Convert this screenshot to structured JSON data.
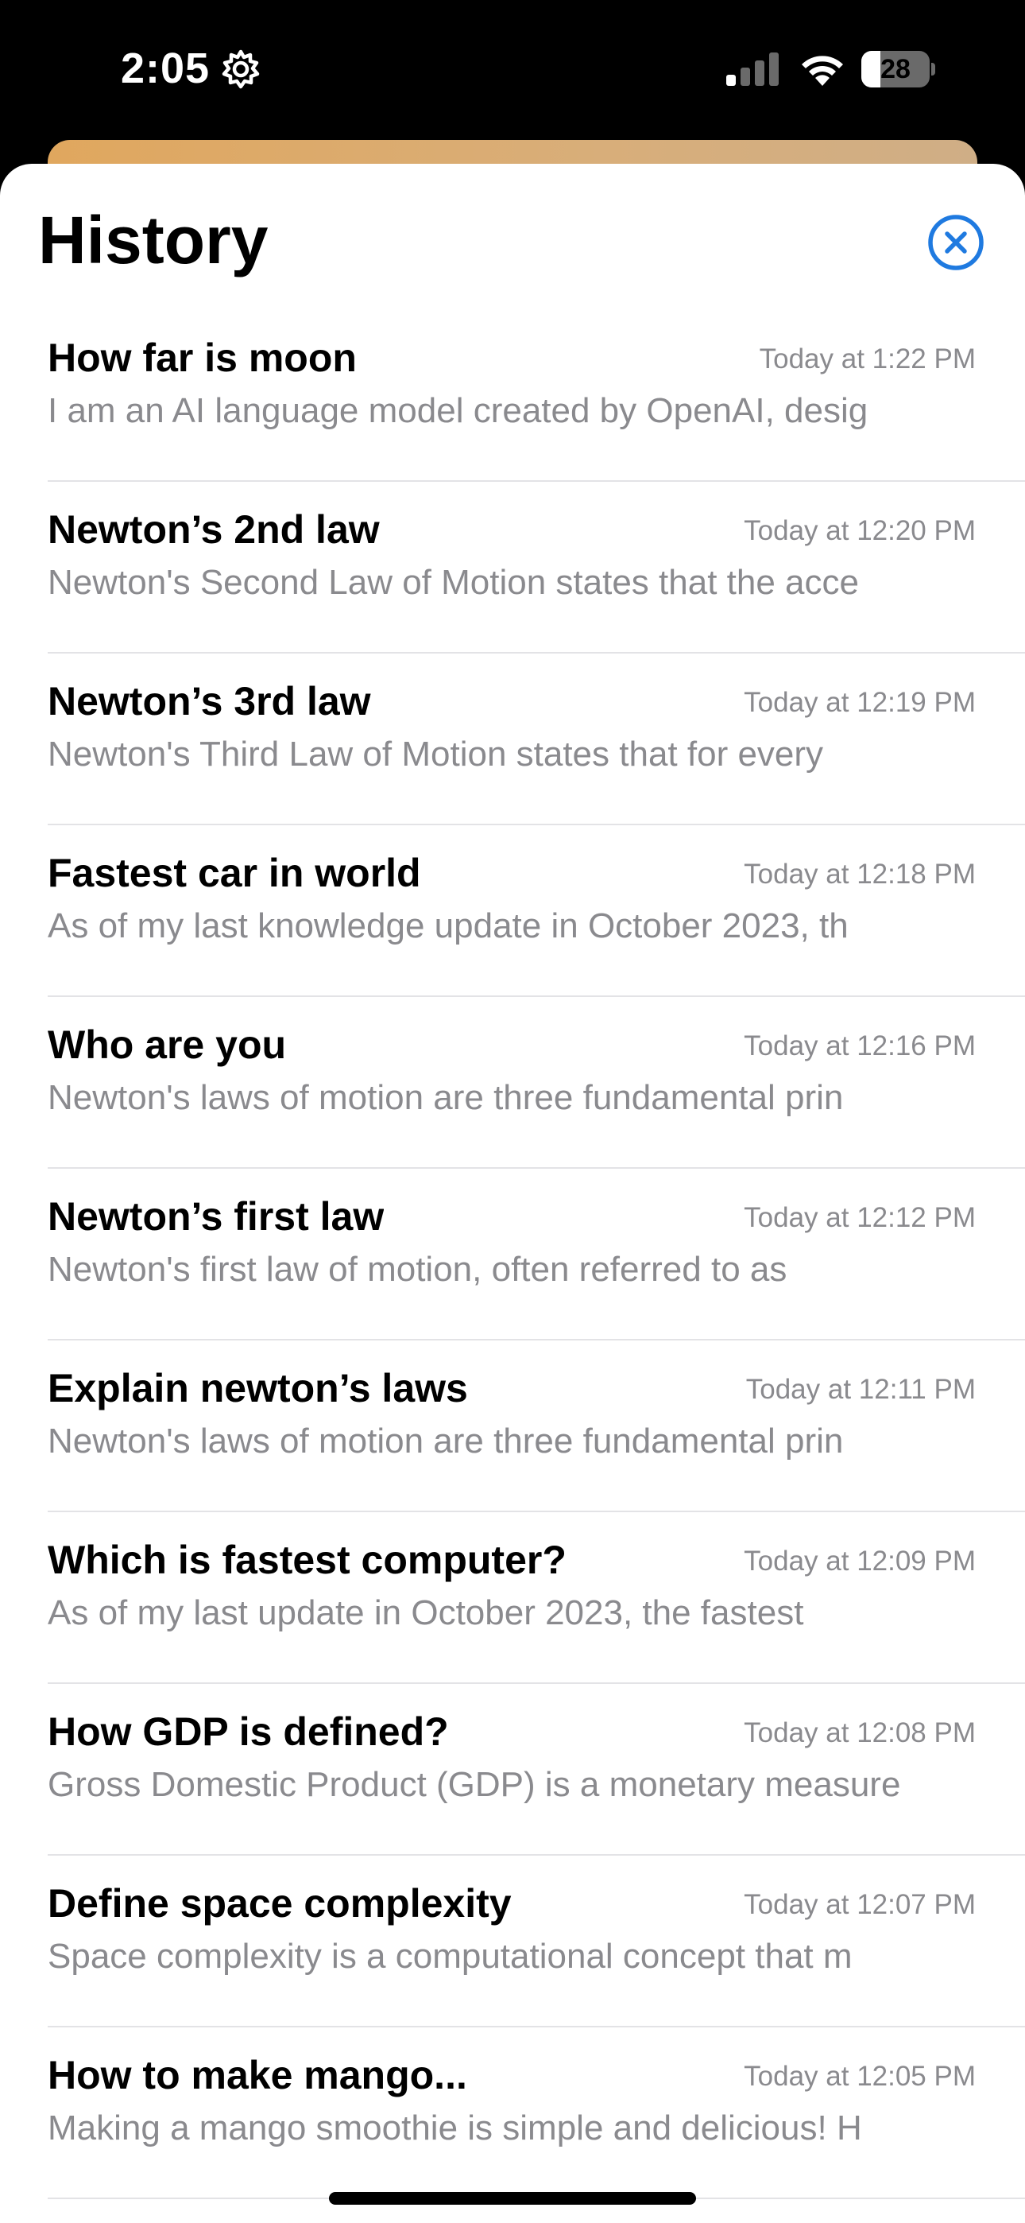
{
  "status_bar": {
    "time": "2:05",
    "battery_level": "28",
    "battery_fraction": 0.28,
    "icons": [
      "gear-icon",
      "cellular-signal-icon",
      "wifi-icon",
      "battery-icon"
    ]
  },
  "sheet": {
    "title": "History",
    "close_icon": "close-circle-icon"
  },
  "colors": {
    "accent": "#1f7ae0",
    "secondary_text": "#8a8a8e",
    "background": "#ffffff"
  },
  "history": [
    {
      "title": "How far is moon",
      "time": "Today at 1:22 PM",
      "preview": "I am an AI language model created by OpenAI, desig"
    },
    {
      "title": "Newton’s 2nd law",
      "time": "Today at 12:20 PM",
      "preview": "Newton's Second Law of Motion states that the acce"
    },
    {
      "title": "Newton’s 3rd law",
      "time": "Today at 12:19 PM",
      "preview": "Newton's Third Law of Motion states that for every"
    },
    {
      "title": "Fastest car in world",
      "time": "Today at 12:18 PM",
      "preview": "As of my last knowledge update in October 2023, th"
    },
    {
      "title": "Who are you",
      "time": "Today at 12:16 PM",
      "preview": "Newton's laws of motion are three fundamental prin"
    },
    {
      "title": "Newton’s first law",
      "time": "Today at 12:12 PM",
      "preview": "Newton's first law of motion, often referred to as"
    },
    {
      "title": "Explain newton’s laws",
      "time": "Today at 12:11 PM",
      "preview": "Newton's laws of motion are three fundamental prin"
    },
    {
      "title": "Which is fastest computer?",
      "time": "Today at 12:09 PM",
      "preview": "As of my last update in October 2023, the fastest"
    },
    {
      "title": "How GDP is defined?",
      "time": "Today at 12:08 PM",
      "preview": "Gross Domestic Product (GDP) is a monetary measure"
    },
    {
      "title": "Define space complexity",
      "time": "Today at 12:07 PM",
      "preview": "Space complexity is a computational concept that m"
    },
    {
      "title": "How to make mango...",
      "time": "Today at 12:05 PM",
      "preview": "Making a mango smoothie is simple and delicious! H"
    }
  ]
}
